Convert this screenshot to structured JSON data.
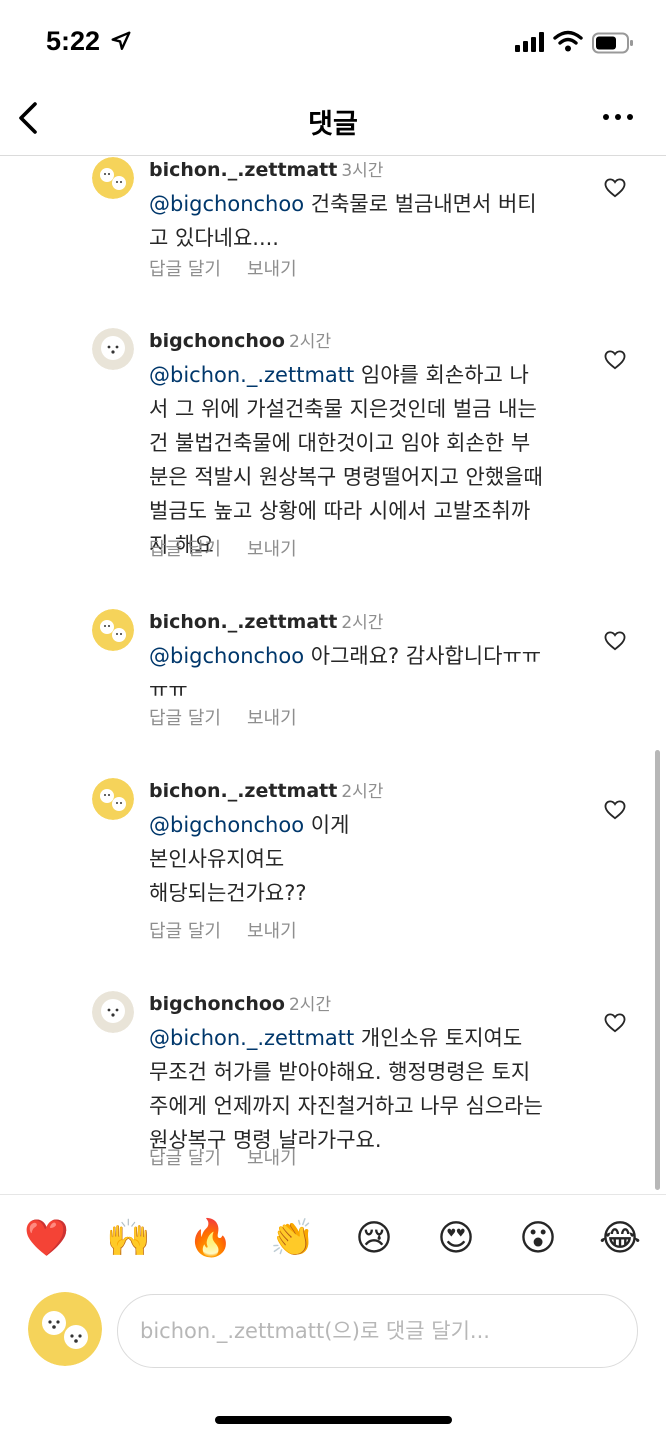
{
  "status_bar": {
    "time": "5:22"
  },
  "header": {
    "title": "댓글"
  },
  "comments": [
    {
      "user": "bichon._.zettmatt",
      "time": "3시간",
      "mention": "@bigchonchoo",
      "lines": [
        "건축물로 벌금내면서 버티",
        "고 있다네요...."
      ],
      "reply_label": "답글 달기",
      "send_label": "보내기"
    },
    {
      "user": "bigchonchoo",
      "time": "2시간",
      "mention": "@bichon._.zettmatt",
      "lines": [
        "임야를 회손하고 나",
        "서 그 위에 가설건축물 지은것인데 벌금 내는",
        "건 불법건축물에 대한것이고 임야 회손한 부",
        "분은 적발시 원상복구 명령떨어지고 안했을때",
        "벌금도 높고 상황에 따라 시에서 고발조취까",
        "지 해요"
      ],
      "reply_label": "답글 달기",
      "send_label": "보내기"
    },
    {
      "user": "bichon._.zettmatt",
      "time": "2시간",
      "mention": "@bigchonchoo",
      "lines": [
        "아그래요? 감사합니다ㅠㅠ",
        "ㅠㅠ"
      ],
      "reply_label": "답글 달기",
      "send_label": "보내기"
    },
    {
      "user": "bichon._.zettmatt",
      "time": "2시간",
      "mention": "@bigchonchoo",
      "lines": [
        "이게",
        "본인사유지여도",
        "해당되는건가요??"
      ],
      "reply_label": "답글 달기",
      "send_label": "보내기"
    },
    {
      "user": "bigchonchoo",
      "time": "2시간",
      "mention": "@bichon._.zettmatt",
      "lines": [
        "개인소유 토지여도",
        "무조건 허가를 받아야해요. 행정명령은 토지",
        "주에게 언제까지 자진철거하고 나무 심으라는",
        "원상복구 명령 날라가구요."
      ],
      "reply_label": "답글 달기",
      "send_label": "보내기"
    }
  ],
  "emoji_bar": [
    "❤️",
    "🙌",
    "🔥",
    "👏",
    "😢",
    "😍",
    "😮",
    "😂"
  ],
  "input": {
    "placeholder": "bichon._.zettmatt(으)로 댓글 달기..."
  },
  "colors": {
    "mention": "#00376b",
    "muted": "#8e8e8e",
    "avatar_bg": "#f5d35a",
    "divider": "#dbdbdb"
  },
  "icons": {
    "back": "chevron-left-icon",
    "more": "more-horizontal-icon",
    "like": "heart-outline-icon",
    "signal": "cellular-signal-icon",
    "wifi": "wifi-icon",
    "battery": "battery-icon",
    "location": "location-arrow-icon"
  }
}
